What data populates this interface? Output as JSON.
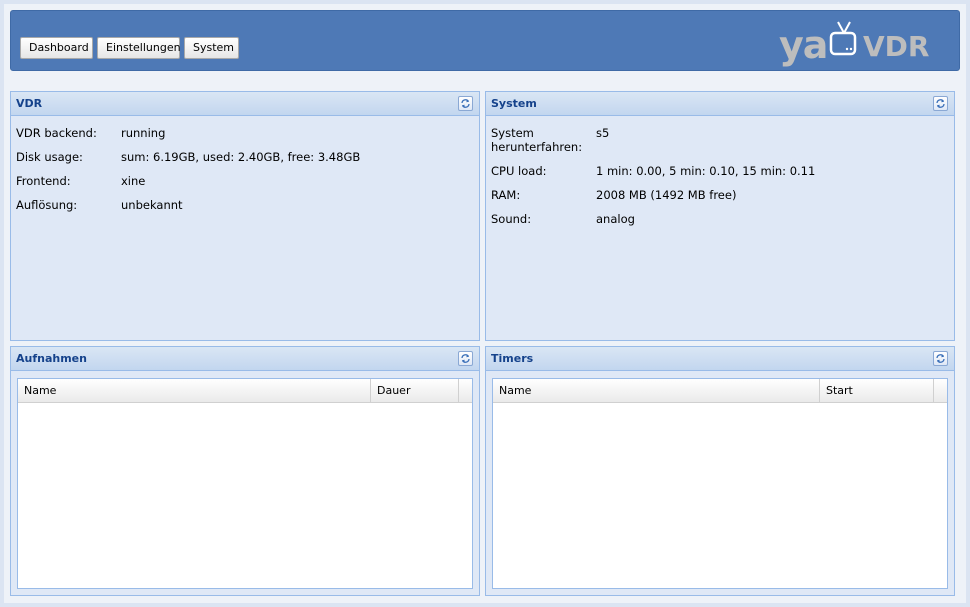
{
  "nav": {
    "dashboard": "Dashboard",
    "einstellungen": "Einstellungen",
    "system": "System"
  },
  "logo": {
    "ya": "ya",
    "vdr": "VDR"
  },
  "vdr_panel": {
    "title": "VDR",
    "rows": [
      {
        "label": "VDR backend:",
        "value": "running"
      },
      {
        "label": "Disk usage:",
        "value": "sum: 6.19GB, used: 2.40GB, free: 3.48GB"
      },
      {
        "label": "Frontend:",
        "value": "xine"
      },
      {
        "label": "Auflösung:",
        "value": "unbekannt"
      }
    ]
  },
  "system_panel": {
    "title": "System",
    "rows": [
      {
        "label": "System herunterfahren:",
        "value": "s5"
      },
      {
        "label": "CPU load:",
        "value": "1 min: 0.00, 5 min: 0.10, 15 min: 0.11"
      },
      {
        "label": "RAM:",
        "value": "2008 MB (1492 MB free)"
      },
      {
        "label": "Sound:",
        "value": "analog"
      }
    ]
  },
  "aufnahmen_panel": {
    "title": "Aufnahmen",
    "columns": [
      "Name",
      "Dauer"
    ]
  },
  "timers_panel": {
    "title": "Timers",
    "columns": [
      "Name",
      "Start"
    ]
  },
  "colors": {
    "header": "#4e79b6",
    "panel_bg": "#dfe8f6",
    "panel_title": "#15428b",
    "logo_gray": "#bdbdbd"
  },
  "icons": {
    "refresh": "refresh-icon",
    "tv": "tv-icon"
  }
}
